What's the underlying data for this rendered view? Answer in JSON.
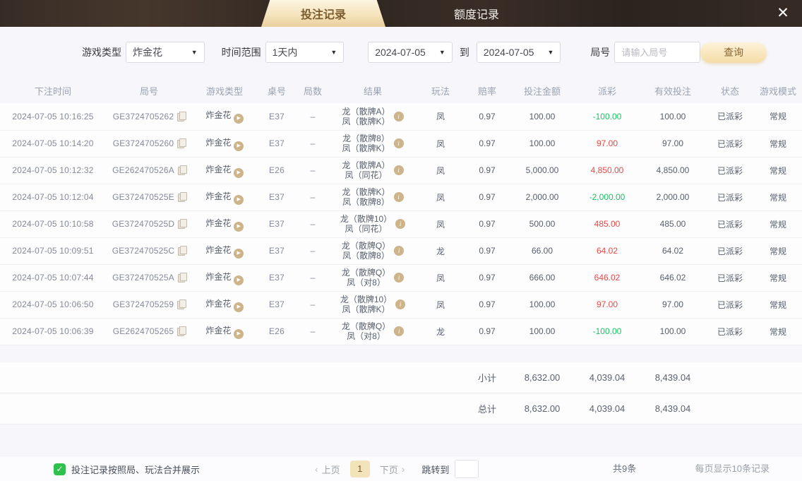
{
  "tabs": {
    "betting": "投注记录",
    "quota": "额度记录"
  },
  "icons": {
    "close": "✕",
    "dropdown_arrow": "▼",
    "play": "▶",
    "info": "i",
    "prev_arrow": "‹",
    "next_arrow": "›",
    "check": "✓"
  },
  "filters": {
    "game_type_label": "游戏类型",
    "game_type_value": "炸金花",
    "time_range_label": "时间范围",
    "time_range_value": "1天内",
    "date_from": "2024-07-05",
    "to_label": "到",
    "date_to": "2024-07-05",
    "round_label": "局号",
    "round_placeholder": "请输入局号",
    "query_button": "查询"
  },
  "table": {
    "headers": [
      "下注时间",
      "局号",
      "游戏类型",
      "桌号",
      "局数",
      "结果",
      "玩法",
      "赔率",
      "投注金额",
      "派彩",
      "有效投注",
      "状态",
      "游戏模式"
    ],
    "rows": [
      {
        "time": "2024-07-05 10:16:25",
        "round": "GE3724705262",
        "game": "炸金花",
        "table_no": "E37",
        "rounds": "–",
        "result1": "龙（散牌A）",
        "result2": "凤（散牌K）",
        "play": "凤",
        "odds": "0.97",
        "bet": "100.00",
        "payout": "-100.00",
        "payout_color": "green",
        "valid": "100.00",
        "status": "已派彩",
        "mode": "常规"
      },
      {
        "time": "2024-07-05 10:14:20",
        "round": "GE3724705260",
        "game": "炸金花",
        "table_no": "E37",
        "rounds": "–",
        "result1": "龙（散牌8）",
        "result2": "凤（散牌K）",
        "play": "凤",
        "odds": "0.97",
        "bet": "100.00",
        "payout": "97.00",
        "payout_color": "red",
        "valid": "97.00",
        "status": "已派彩",
        "mode": "常规"
      },
      {
        "time": "2024-07-05 10:12:32",
        "round": "GE262470526A",
        "game": "炸金花",
        "table_no": "E26",
        "rounds": "–",
        "result1": "龙（散牌A）",
        "result2": "凤（同花）",
        "play": "凤",
        "odds": "0.97",
        "bet": "5,000.00",
        "payout": "4,850.00",
        "payout_color": "red",
        "valid": "4,850.00",
        "status": "已派彩",
        "mode": "常规"
      },
      {
        "time": "2024-07-05 10:12:04",
        "round": "GE372470525E",
        "game": "炸金花",
        "table_no": "E37",
        "rounds": "–",
        "result1": "龙（散牌K）",
        "result2": "凤（散牌8）",
        "play": "凤",
        "odds": "0.97",
        "bet": "2,000.00",
        "payout": "-2,000.00",
        "payout_color": "green",
        "valid": "2,000.00",
        "status": "已派彩",
        "mode": "常规"
      },
      {
        "time": "2024-07-05 10:10:58",
        "round": "GE372470525D",
        "game": "炸金花",
        "table_no": "E37",
        "rounds": "–",
        "result1": "龙（散牌10）",
        "result2": "凤（同花）",
        "play": "凤",
        "odds": "0.97",
        "bet": "500.00",
        "payout": "485.00",
        "payout_color": "red",
        "valid": "485.00",
        "status": "已派彩",
        "mode": "常规"
      },
      {
        "time": "2024-07-05 10:09:51",
        "round": "GE372470525C",
        "game": "炸金花",
        "table_no": "E37",
        "rounds": "–",
        "result1": "龙（散牌Q）",
        "result2": "凤（散牌8）",
        "play": "龙",
        "odds": "0.97",
        "bet": "66.00",
        "payout": "64.02",
        "payout_color": "red",
        "valid": "64.02",
        "status": "已派彩",
        "mode": "常规"
      },
      {
        "time": "2024-07-05 10:07:44",
        "round": "GE372470525A",
        "game": "炸金花",
        "table_no": "E37",
        "rounds": "–",
        "result1": "龙（散牌Q）",
        "result2": "凤（对8）",
        "play": "凤",
        "odds": "0.97",
        "bet": "666.00",
        "payout": "646.02",
        "payout_color": "red",
        "valid": "646.02",
        "status": "已派彩",
        "mode": "常规"
      },
      {
        "time": "2024-07-05 10:06:50",
        "round": "GE3724705259",
        "game": "炸金花",
        "table_no": "E37",
        "rounds": "–",
        "result1": "龙（散牌10）",
        "result2": "凤（散牌K）",
        "play": "凤",
        "odds": "0.97",
        "bet": "100.00",
        "payout": "97.00",
        "payout_color": "red",
        "valid": "97.00",
        "status": "已派彩",
        "mode": "常规"
      },
      {
        "time": "2024-07-05 10:06:39",
        "round": "GE2624705265",
        "game": "炸金花",
        "table_no": "E26",
        "rounds": "–",
        "result1": "龙（散牌Q）",
        "result2": "凤（对8）",
        "play": "龙",
        "odds": "0.97",
        "bet": "100.00",
        "payout": "-100.00",
        "payout_color": "green",
        "valid": "100.00",
        "status": "已派彩",
        "mode": "常规"
      }
    ],
    "subtotal": {
      "label": "小计",
      "bet": "8,632.00",
      "payout": "4,039.04",
      "valid": "8,439.04"
    },
    "total": {
      "label": "总计",
      "bet": "8,632.00",
      "payout": "4,039.04",
      "valid": "8,439.04"
    }
  },
  "footer": {
    "merge_checkbox_label": "投注记录按照局、玩法合并展示",
    "prev": "上页",
    "page": "1",
    "next": "下页",
    "jump_label": "跳转到",
    "total_count": "共9条",
    "page_size": "每页显示10条记录"
  },
  "colors": {
    "accent_gold": "#e9cf9d",
    "positive_red": "#e14b48",
    "negative_green": "#1ec463",
    "checkbox_green": "#2fc14e"
  }
}
